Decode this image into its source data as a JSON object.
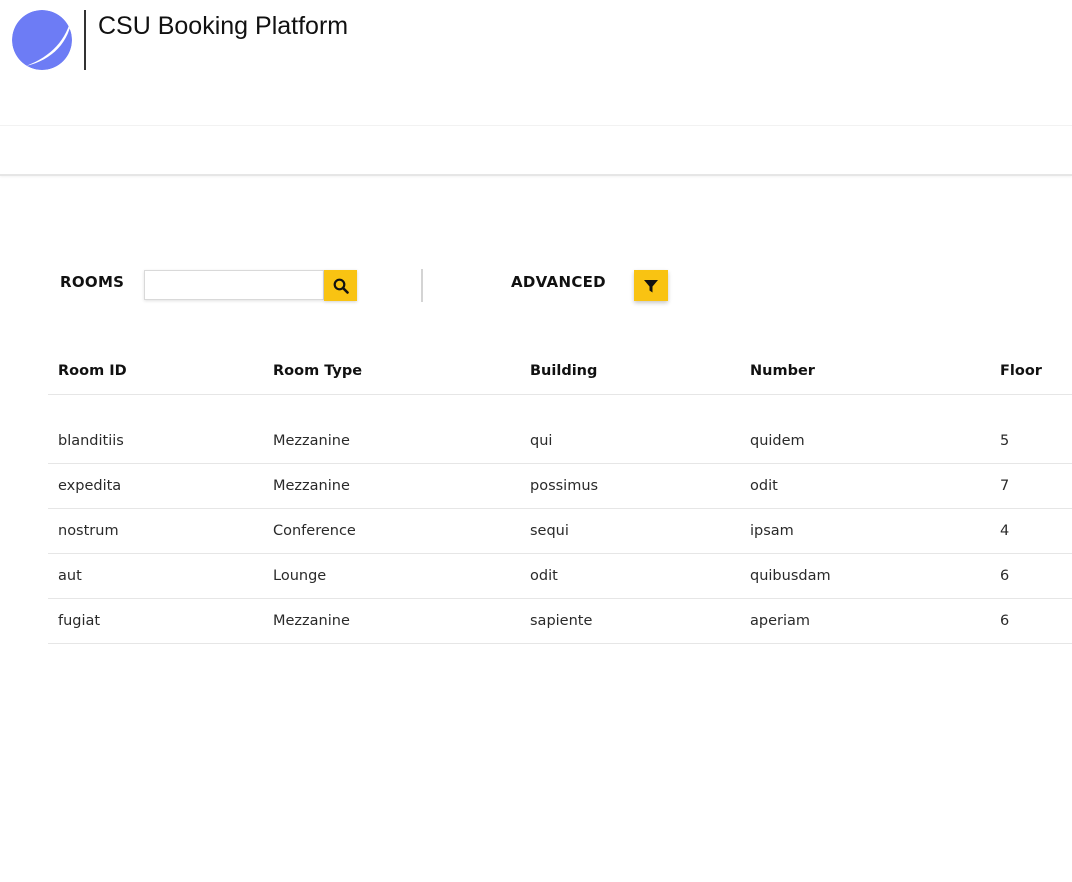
{
  "app": {
    "title": "CSU Booking Platform",
    "logo_icon": "globe-logo-icon",
    "accent_color": "#f9c312",
    "logo_color": "#6d7cf5"
  },
  "toolbar": {
    "rooms_label": "ROOMS",
    "search_value": "",
    "search_placeholder": "",
    "search_icon": "search-icon",
    "advanced_label": "ADVANCED",
    "filter_icon": "filter-icon"
  },
  "table": {
    "columns": [
      "Room ID",
      "Room Type",
      "Building",
      "Number",
      "Floor"
    ],
    "rows": [
      [
        "blanditiis",
        "Mezzanine",
        "qui",
        "quidem",
        "5"
      ],
      [
        "expedita",
        "Mezzanine",
        "possimus",
        "odit",
        "7"
      ],
      [
        "nostrum",
        "Conference",
        "sequi",
        "ipsam",
        "4"
      ],
      [
        "aut",
        "Lounge",
        "odit",
        "quibusdam",
        "6"
      ],
      [
        "fugiat",
        "Mezzanine",
        "sapiente",
        "aperiam",
        "6"
      ]
    ]
  }
}
